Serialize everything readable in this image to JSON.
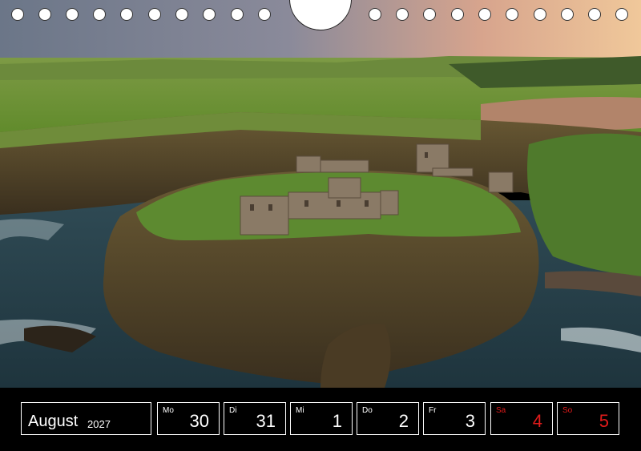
{
  "calendar": {
    "month": "August",
    "year": "2027",
    "days": [
      {
        "abbr": "Mo",
        "num": "30",
        "weekend": false
      },
      {
        "abbr": "Di",
        "num": "31",
        "weekend": false
      },
      {
        "abbr": "Mi",
        "num": "1",
        "weekend": false
      },
      {
        "abbr": "Do",
        "num": "2",
        "weekend": false
      },
      {
        "abbr": "Fr",
        "num": "3",
        "weekend": false
      },
      {
        "abbr": "Sa",
        "num": "4",
        "weekend": true
      },
      {
        "abbr": "So",
        "num": "5",
        "weekend": true
      }
    ]
  },
  "colors": {
    "weekend": "#e01b1b",
    "text": "#ffffff",
    "background": "#000000"
  }
}
